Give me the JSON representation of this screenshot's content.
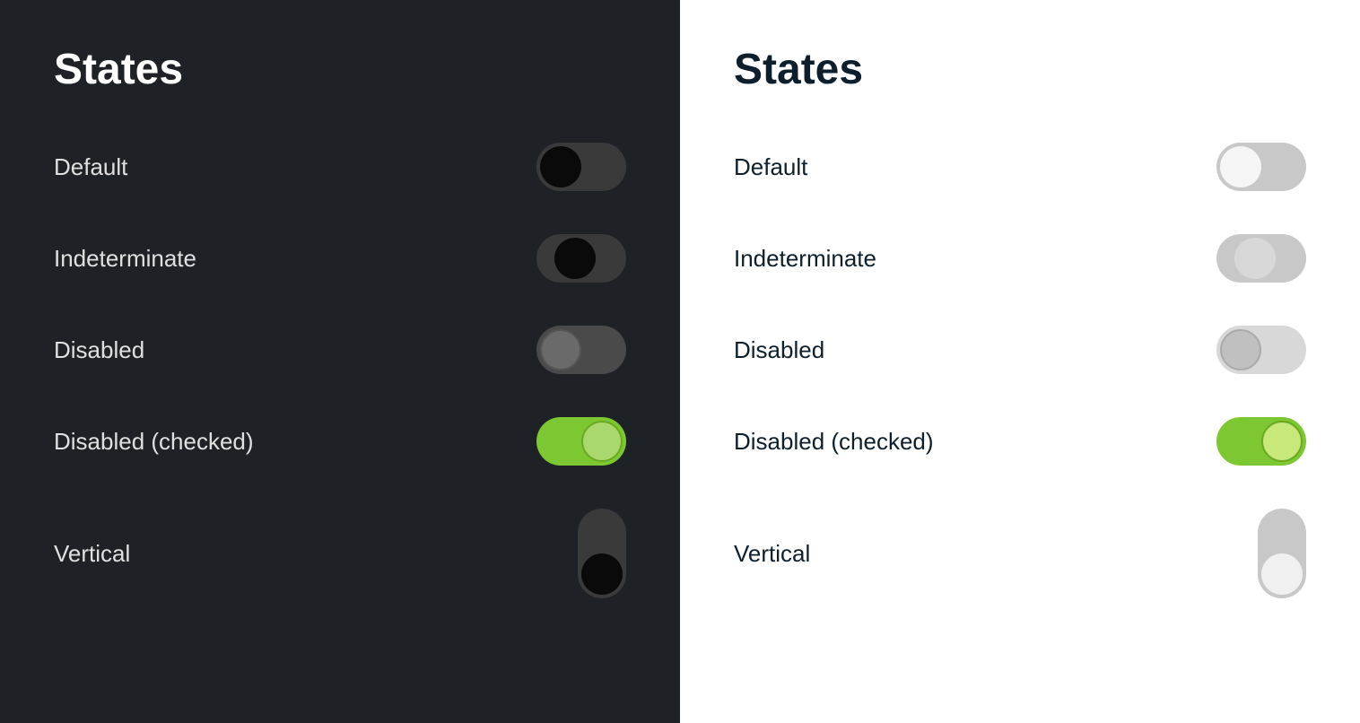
{
  "dark_panel": {
    "title": "States",
    "states": [
      {
        "id": "default",
        "label": "Default"
      },
      {
        "id": "indeterminate",
        "label": "Indeterminate"
      },
      {
        "id": "disabled",
        "label": "Disabled"
      },
      {
        "id": "disabled-checked",
        "label": "Disabled (checked)"
      },
      {
        "id": "vertical",
        "label": "Vertical"
      }
    ]
  },
  "light_panel": {
    "title": "States",
    "states": [
      {
        "id": "default",
        "label": "Default"
      },
      {
        "id": "indeterminate",
        "label": "Indeterminate"
      },
      {
        "id": "disabled",
        "label": "Disabled"
      },
      {
        "id": "disabled-checked",
        "label": "Disabled (checked)"
      },
      {
        "id": "vertical",
        "label": "Vertical"
      }
    ]
  }
}
